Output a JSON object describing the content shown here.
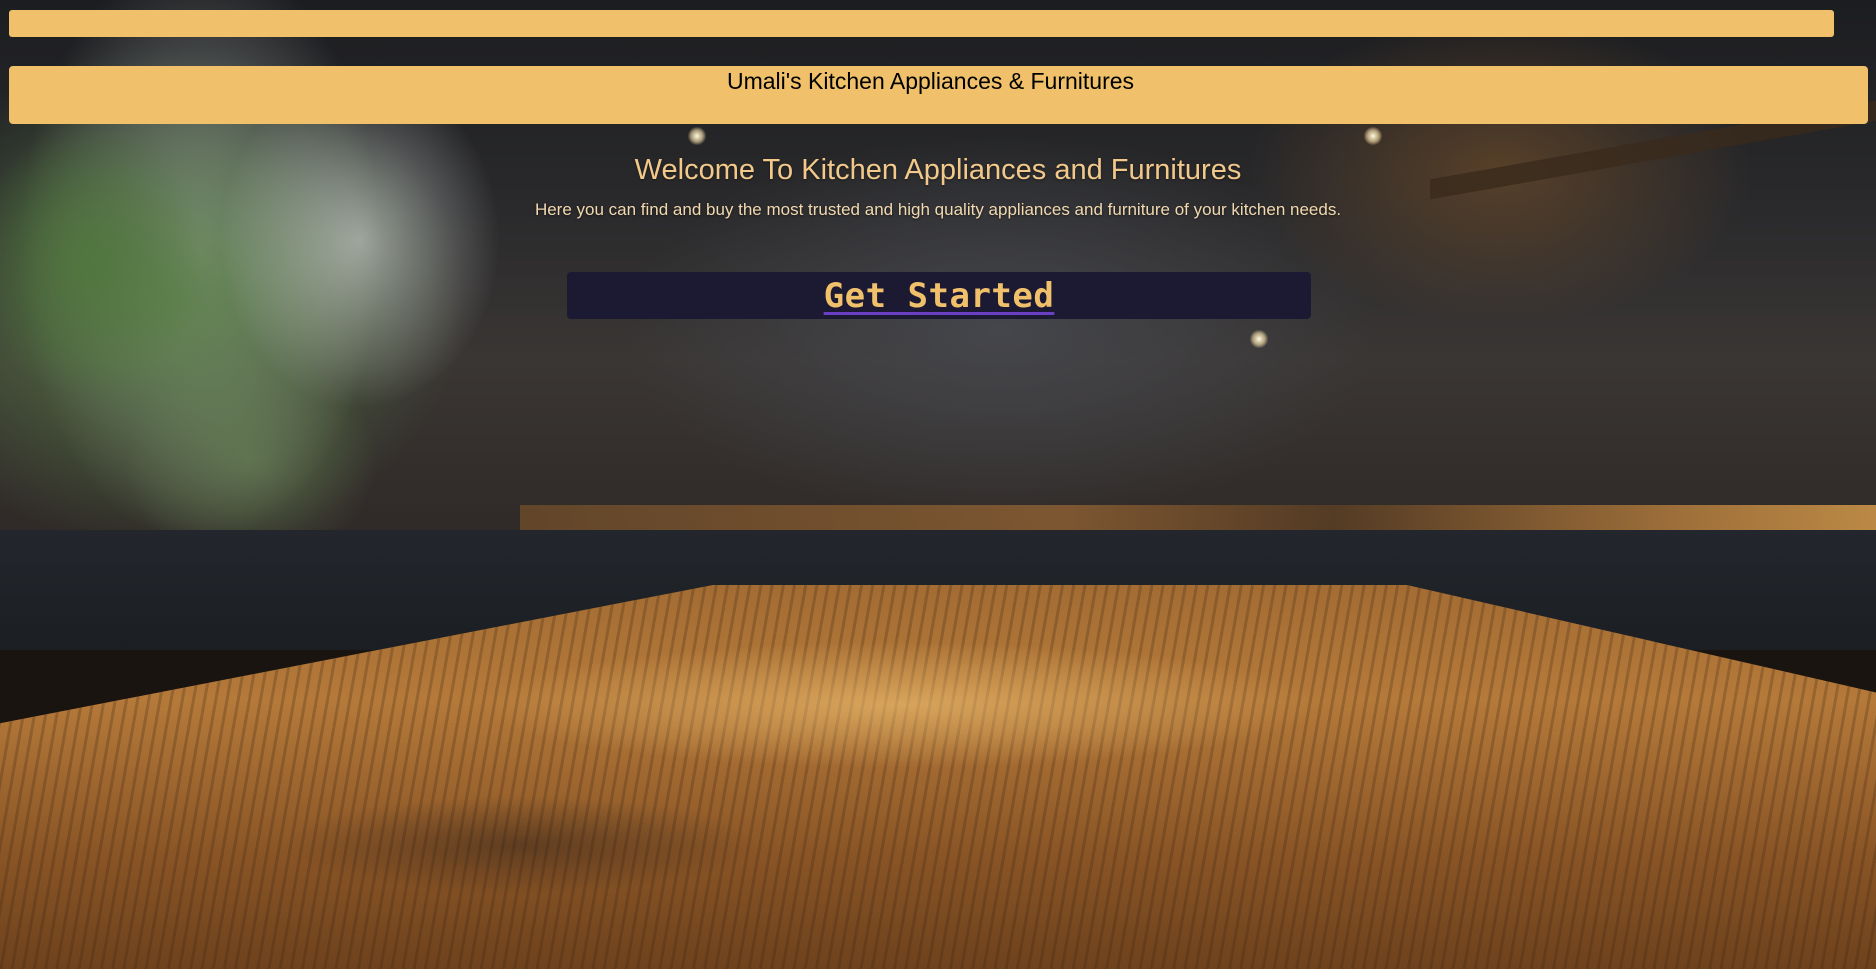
{
  "header": {
    "brand_title": "Umali's Kitchen Appliances & Furnitures"
  },
  "hero": {
    "title": "Welcome To Kitchen Appliances and Furnitures",
    "subtitle": "Here you can find and buy the most trusted and high quality appliances and furniture of your kitchen needs.",
    "cta_label": "Get Started"
  },
  "background": {
    "image": "kitchen-wooden-table-photo"
  },
  "colors": {
    "accent": "#f0c06a",
    "button_bg": "#1c1a33",
    "heading_text": "#f2c98a",
    "link_underline": "#6a3fc4"
  }
}
